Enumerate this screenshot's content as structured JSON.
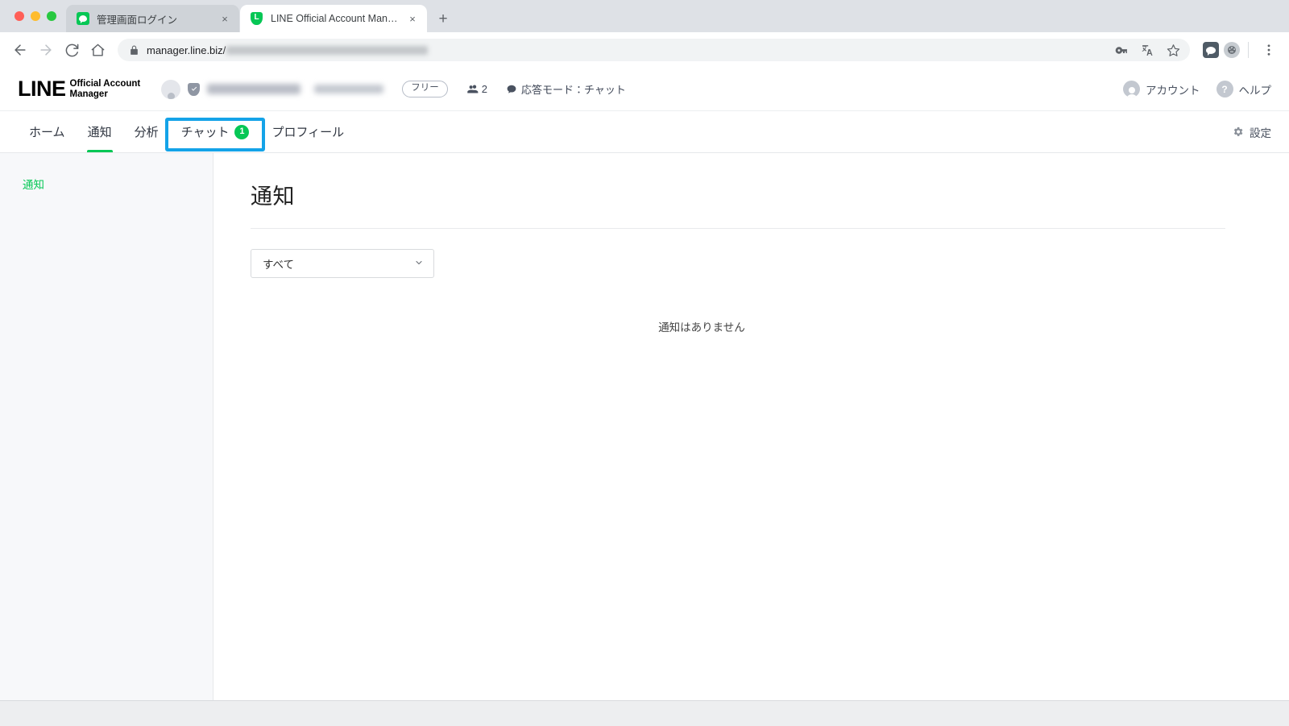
{
  "browser": {
    "window_controls": [
      "close",
      "minimize",
      "maximize"
    ],
    "tabs": [
      {
        "title": "管理画面ログイン",
        "favicon": "line-chat-icon",
        "active": false,
        "close_label": "×"
      },
      {
        "title": "LINE Official Account Manager",
        "favicon": "line-shield-icon",
        "active": true,
        "close_label": "×"
      }
    ],
    "new_tab_label": "+",
    "toolbar": {
      "back_label": "戻る",
      "forward_label": "進む",
      "reload_label": "再読み込み",
      "home_label": "ホーム",
      "url_visible": "manager.line.biz/",
      "url_redacted": true,
      "menu_label": "⋮",
      "icons": [
        "key-icon",
        "translate-icon",
        "bookmark-star-icon",
        "line-extension-icon",
        "extension-circle-icon",
        "browser-menu-icon"
      ]
    }
  },
  "app": {
    "logo": {
      "primary": "LINE",
      "secondary_line1": "Official Account",
      "secondary_line2": "Manager"
    },
    "account": {
      "name_redacted": true,
      "id_redacted": true,
      "plan_label": "フリー",
      "friend_count": "2",
      "response_mode": "応答モード：チャット"
    },
    "header_right": [
      {
        "label": "アカウント",
        "icon": "account-avatar-icon"
      },
      {
        "label": "ヘルプ",
        "icon": "help-question-icon"
      }
    ],
    "nav": {
      "tabs": [
        {
          "label": "ホーム",
          "active": false,
          "badge": null
        },
        {
          "label": "通知",
          "active": true,
          "badge": null
        },
        {
          "label": "分析",
          "active": false,
          "badge": null
        },
        {
          "label": "チャット",
          "active": false,
          "badge": "1",
          "highlighted": true
        },
        {
          "label": "プロフィール",
          "active": false,
          "badge": null
        }
      ],
      "settings_label": "設定"
    },
    "sidebar": {
      "items": [
        {
          "label": "通知",
          "active": true
        }
      ]
    },
    "main": {
      "title": "通知",
      "filter": {
        "selected": "すべて",
        "options": [
          "すべて"
        ]
      },
      "empty_message": "通知はありません"
    }
  },
  "colors": {
    "line_green": "#06c755",
    "annotation_blue": "#14a3e8",
    "sidebar_bg": "#f7f8fa",
    "text_primary": "#2f3540"
  }
}
